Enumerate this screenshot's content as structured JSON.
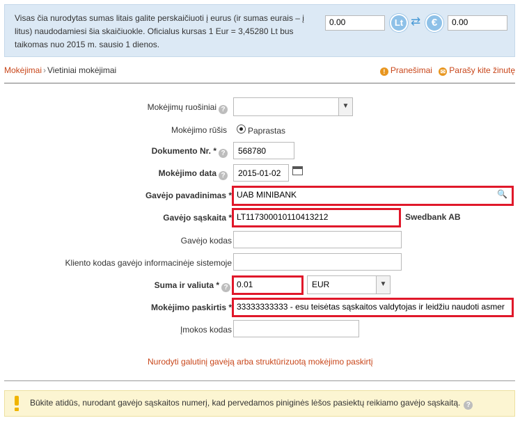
{
  "converter": {
    "text": "Visas čia nurodytas sumas litais galite perskaičiuoti į eurus (ir sumas eurais – į litus) naudodamiesi šia skaičiuokle. Oficialus kursas 1 Eur = 3,45280 Lt bus taikomas nuo 2015 m. sausio 1 dienos.",
    "lt_value": "0.00",
    "eur_value": "0.00",
    "lt_symbol": "Lt",
    "eur_symbol": "€",
    "swap_symbol": "⇄"
  },
  "breadcrumb": {
    "root": "Mokėjimai",
    "separator": "›",
    "current": "Vietiniai mokėjimai"
  },
  "top_links": {
    "messages": "Pranešimai",
    "write_message": "Parašy kite žinutę"
  },
  "form": {
    "templates_label": "Mokėjimų ruošiniai",
    "templates_value": "",
    "type_label": "Mokėjimo rūšis",
    "type_value": "Paprastas",
    "doc_no_label": "Dokumento Nr. *",
    "doc_no_value": "568780",
    "date_label": "Mokėjimo data",
    "date_value": "2015-01-02",
    "recipient_name_label": "Gavėjo pavadinimas *",
    "recipient_name_value": "UAB MINIBANK",
    "recipient_account_label": "Gavėjo sąskaita *",
    "recipient_account_value": "LT117300010110413212",
    "bank_name": "Swedbank AB",
    "recipient_code_label": "Gavėjo kodas",
    "recipient_code_value": "",
    "client_code_label": "Kliento kodas gavėjo informacinėje sistemoje",
    "client_code_value": "",
    "amount_label": "Suma ir valiuta *",
    "amount_value": "0.01",
    "currency_value": "EUR",
    "purpose_label": "Mokėjimo paskirtis *",
    "purpose_value": "33333333333 - esu teisėtas sąskaitos valdytojas ir leidžiu naudoti asmer",
    "ref_code_label": "Įmokos kodas",
    "ref_code_value": "",
    "final_recipient_link": "Nurodyti galutinį gavėją arba struktūrizuotą mokėjimo paskirtį"
  },
  "warning": {
    "text": "Būkite atidūs, nurodant gavėjo sąskaitos numerį, kad pervedamos piniginės lėšos pasiektų reikiamo gavėjo sąskaitą."
  },
  "colors": {
    "accent_link": "#c8461a",
    "highlight_border": "#e0182a",
    "banner_bg": "#dce9f5",
    "warning_bg": "#fcf5d2"
  }
}
